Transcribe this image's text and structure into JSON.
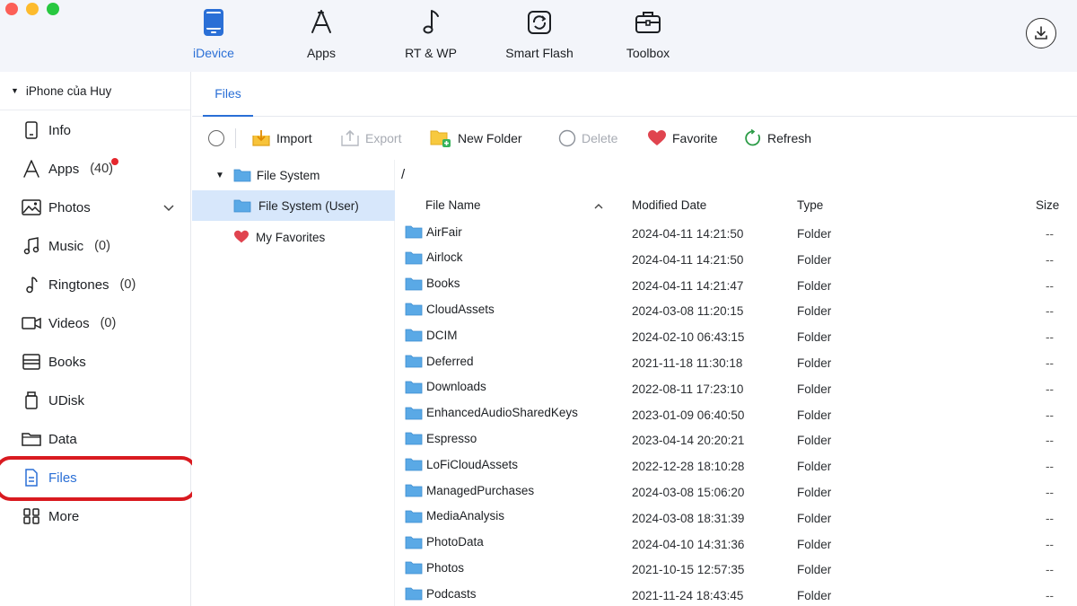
{
  "window": {
    "traffic_lights": [
      "close",
      "minimize",
      "zoom"
    ]
  },
  "nav": {
    "tabs": [
      {
        "label": "iDevice",
        "icon": "tablet-icon",
        "active": true
      },
      {
        "label": "Apps",
        "icon": "app-store-icon",
        "active": false
      },
      {
        "label": "RT & WP",
        "icon": "music-note-icon",
        "active": false
      },
      {
        "label": "Smart Flash",
        "icon": "flash-refresh-icon",
        "active": false
      },
      {
        "label": "Toolbox",
        "icon": "toolbox-icon",
        "active": false
      }
    ],
    "download_icon": "download-icon"
  },
  "sidebar": {
    "device_name": "iPhone của Huy",
    "items": [
      {
        "label": "Info",
        "count": "",
        "icon": "phone-info-icon"
      },
      {
        "label": "Apps",
        "count": "(40)",
        "icon": "apps-icon",
        "badge": true
      },
      {
        "label": "Photos",
        "count": "",
        "icon": "photos-icon",
        "expandable": true
      },
      {
        "label": "Music",
        "count": "(0)",
        "icon": "music-icon"
      },
      {
        "label": "Ringtones",
        "count": "(0)",
        "icon": "ringtone-icon"
      },
      {
        "label": "Videos",
        "count": "(0)",
        "icon": "video-icon"
      },
      {
        "label": "Books",
        "count": "",
        "icon": "books-icon"
      },
      {
        "label": "UDisk",
        "count": "",
        "icon": "udisk-icon"
      },
      {
        "label": "Data",
        "count": "",
        "icon": "data-folder-icon"
      },
      {
        "label": "Files",
        "count": "",
        "icon": "file-icon",
        "active": true
      },
      {
        "label": "More",
        "count": "",
        "icon": "more-grid-icon"
      }
    ]
  },
  "tabs": {
    "files": "Files"
  },
  "toolbar": {
    "import": "Import",
    "export": "Export",
    "new_folder": "New Folder",
    "delete": "Delete",
    "favorite": "Favorite",
    "refresh": "Refresh"
  },
  "tree": {
    "root": "File System",
    "child": "File System (User)",
    "favorites": "My Favorites"
  },
  "path": "/",
  "table": {
    "headers": {
      "name": "File Name",
      "date": "Modified Date",
      "type": "Type",
      "size": "Size"
    },
    "rows": [
      {
        "name": "AirFair",
        "date": "2024-04-11 14:21:50",
        "type": "Folder",
        "size": "--"
      },
      {
        "name": "Airlock",
        "date": "2024-04-11 14:21:50",
        "type": "Folder",
        "size": "--"
      },
      {
        "name": "Books",
        "date": "2024-04-11 14:21:47",
        "type": "Folder",
        "size": "--"
      },
      {
        "name": "CloudAssets",
        "date": "2024-03-08 11:20:15",
        "type": "Folder",
        "size": "--"
      },
      {
        "name": "DCIM",
        "date": "2024-02-10 06:43:15",
        "type": "Folder",
        "size": "--"
      },
      {
        "name": "Deferred",
        "date": "2021-11-18 11:30:18",
        "type": "Folder",
        "size": "--"
      },
      {
        "name": "Downloads",
        "date": "2022-08-11 17:23:10",
        "type": "Folder",
        "size": "--"
      },
      {
        "name": "EnhancedAudioSharedKeys",
        "date": "2023-01-09 06:40:50",
        "type": "Folder",
        "size": "--"
      },
      {
        "name": "Espresso",
        "date": "2023-04-14 20:20:21",
        "type": "Folder",
        "size": "--"
      },
      {
        "name": "LoFiCloudAssets",
        "date": "2022-12-28 18:10:28",
        "type": "Folder",
        "size": "--"
      },
      {
        "name": "ManagedPurchases",
        "date": "2024-03-08 15:06:20",
        "type": "Folder",
        "size": "--"
      },
      {
        "name": "MediaAnalysis",
        "date": "2024-03-08 18:31:39",
        "type": "Folder",
        "size": "--"
      },
      {
        "name": "PhotoData",
        "date": "2024-04-10 14:31:36",
        "type": "Folder",
        "size": "--"
      },
      {
        "name": "Photos",
        "date": "2021-10-15 12:57:35",
        "type": "Folder",
        "size": "--"
      },
      {
        "name": "Podcasts",
        "date": "2021-11-24 18:43:45",
        "type": "Folder",
        "size": "--"
      }
    ]
  },
  "colors": {
    "accent": "#2a6fd6",
    "folder": "#5aa9e6",
    "highlight_ring": "#d91a20",
    "selected_row": "#d7e7fb",
    "badge": "#e5262d"
  }
}
